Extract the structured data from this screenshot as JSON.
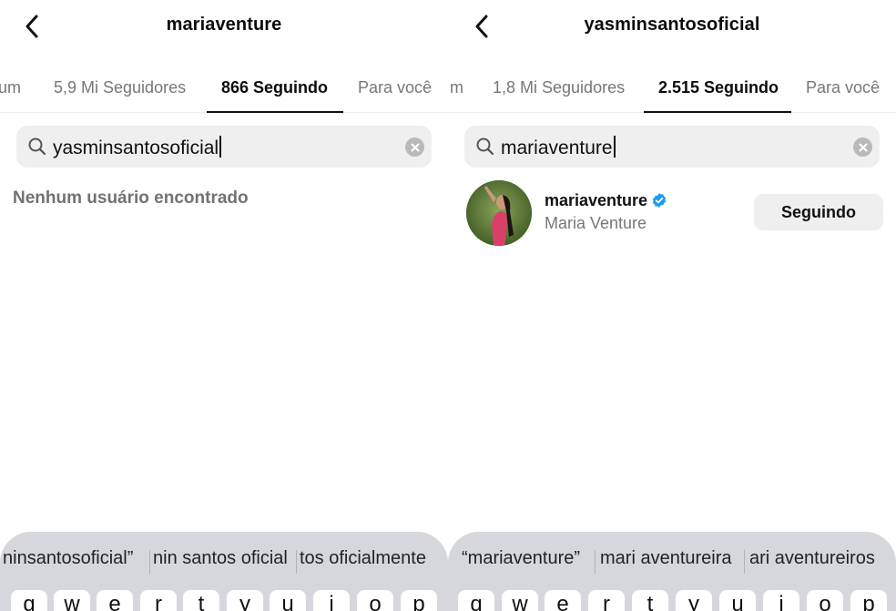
{
  "left": {
    "header_title": "mariaventure",
    "tabs": [
      {
        "label": "um",
        "active": false
      },
      {
        "label": "5,9 Mi Seguidores",
        "active": false
      },
      {
        "label": "866 Seguindo",
        "active": true
      },
      {
        "label": "Para você",
        "active": false
      }
    ],
    "search": {
      "value": "yasminsantosoficial"
    },
    "empty_message": "Nenhum usuário encontrado",
    "keyboard": {
      "suggestions": [
        "ninsantosoficial”",
        "nin santos oficial",
        "tos oficialmente"
      ],
      "keys": [
        "q",
        "w",
        "e",
        "r",
        "t",
        "y",
        "u",
        "i",
        "o",
        "p"
      ]
    }
  },
  "right": {
    "header_title": "yasminsantosoficial",
    "tabs": [
      {
        "label": "m",
        "active": false
      },
      {
        "label": "1,8 Mi Seguidores",
        "active": false
      },
      {
        "label": "2.515 Seguindo",
        "active": true
      },
      {
        "label": "Para você",
        "active": false
      }
    ],
    "search": {
      "value": "mariaventure"
    },
    "result": {
      "username": "mariaventure",
      "full_name": "Maria Venture",
      "verified": true,
      "button_label": "Seguindo"
    },
    "keyboard": {
      "suggestions": [
        "“mariaventure”",
        "mari aventureira",
        "ari aventureiros"
      ],
      "keys": [
        "q",
        "w",
        "e",
        "r",
        "t",
        "y",
        "u",
        "i",
        "o",
        "p"
      ]
    }
  },
  "colors": {
    "verified_blue": "#1d9bf0",
    "muted_text": "#777777",
    "search_bg": "#efefef",
    "keyboard_bg": "#d6d7dc"
  }
}
